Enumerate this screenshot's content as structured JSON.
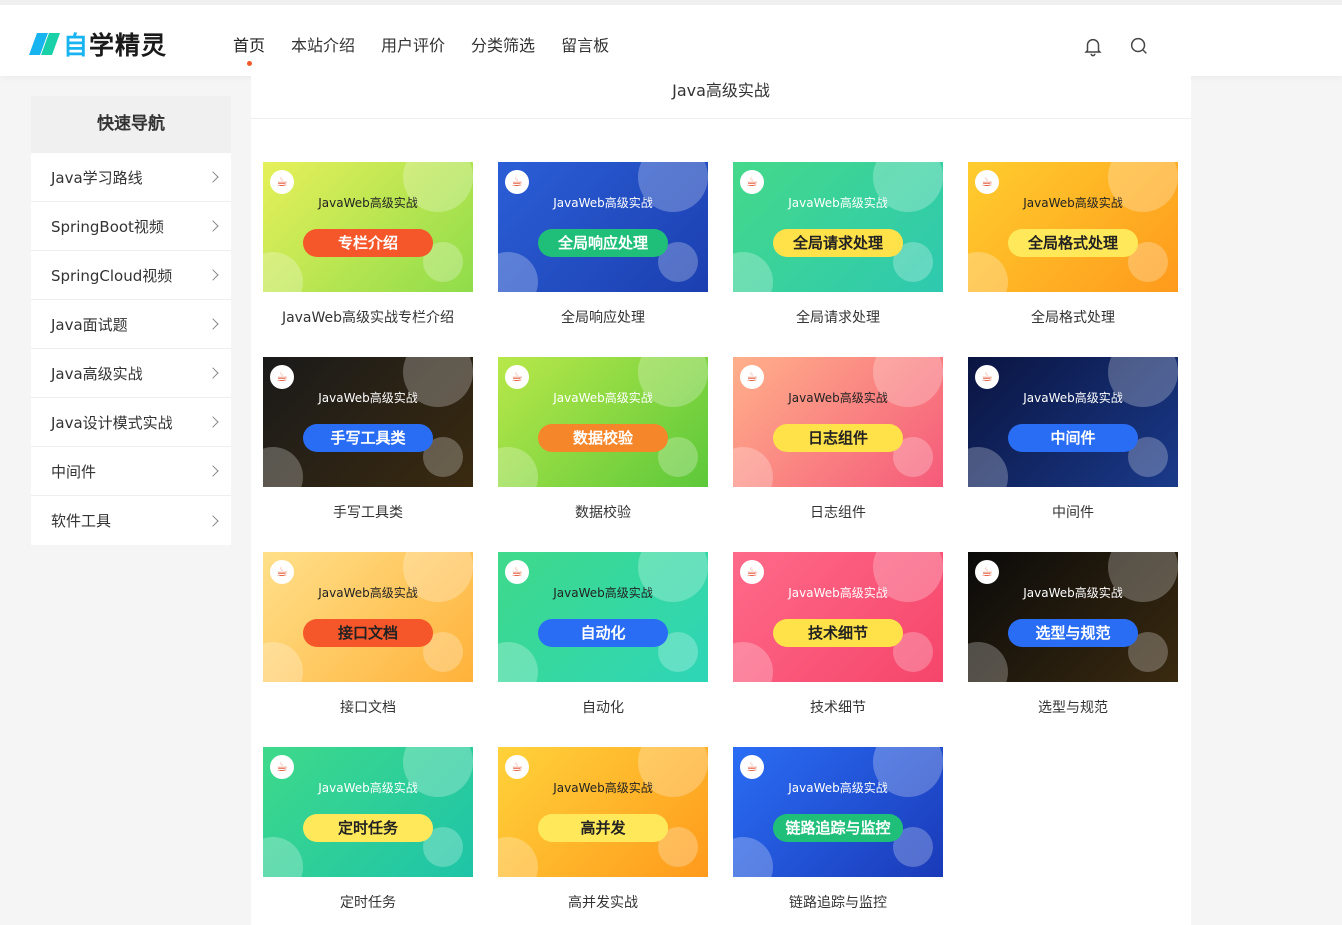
{
  "header": {
    "logo_text_1": "自",
    "logo_text_2": "学精灵",
    "nav": [
      {
        "label": "首页",
        "active": true
      },
      {
        "label": "本站介绍"
      },
      {
        "label": "用户评价"
      },
      {
        "label": "分类筛选"
      },
      {
        "label": "留言板"
      }
    ],
    "bell_icon": "bell-icon",
    "search_icon": "search-icon"
  },
  "sidebar": {
    "title": "快速导航",
    "items": [
      {
        "label": "Java学习路线"
      },
      {
        "label": "SpringBoot视频"
      },
      {
        "label": "SpringCloud视频"
      },
      {
        "label": "Java面试题"
      },
      {
        "label": "Java高级实战"
      },
      {
        "label": "Java设计模式实战"
      },
      {
        "label": "中间件"
      },
      {
        "label": "软件工具"
      }
    ]
  },
  "main": {
    "title": "Java高级实战",
    "card_subtitle": "JavaWeb高级实战",
    "cards": [
      {
        "pill": "专栏介绍",
        "caption": "JavaWeb高级实战专栏介绍",
        "bg": "linear-gradient(135deg,#e6f05a,#8fdc4a)",
        "pill_bg": "#f5562a",
        "pill_fg": "#fff",
        "sub_light": false
      },
      {
        "pill": "全局响应处理",
        "caption": "全局响应处理",
        "bg": "linear-gradient(135deg,#2b5ed6,#1b3fb0)",
        "pill_bg": "#1fbf7a",
        "pill_fg": "#fff",
        "sub_light": true
      },
      {
        "pill": "全局请求处理",
        "caption": "全局请求处理",
        "bg": "linear-gradient(135deg,#44d98a,#2ec9b0)",
        "pill_bg": "#ffe14a",
        "pill_fg": "#222",
        "sub_light": true
      },
      {
        "pill": "全局格式处理",
        "caption": "全局格式处理",
        "bg": "linear-gradient(135deg,#ffcd2e,#ff9a1c)",
        "pill_bg": "#ffe95a",
        "pill_fg": "#222",
        "sub_light": false
      },
      {
        "pill": "手写工具类",
        "caption": "手写工具类",
        "bg": "linear-gradient(135deg,#1a1a1a,#3a2a10)",
        "pill_bg": "#2a6df5",
        "pill_fg": "#fff",
        "sub_light": true
      },
      {
        "pill": "数据校验",
        "caption": "数据校验",
        "bg": "linear-gradient(135deg,#b8e84a,#5cc83a)",
        "pill_bg": "#f5862a",
        "pill_fg": "#fff",
        "sub_light": true
      },
      {
        "pill": "日志组件",
        "caption": "日志组件",
        "bg": "linear-gradient(135deg,#ffb08a,#f55a7a)",
        "pill_bg": "#ffe14a",
        "pill_fg": "#222",
        "sub_light": false
      },
      {
        "pill": "中间件",
        "caption": "中间件",
        "bg": "linear-gradient(135deg,#0a1440,#1a3a8a)",
        "pill_bg": "#2a6df5",
        "pill_fg": "#fff",
        "sub_light": true
      },
      {
        "pill": "接口文档",
        "caption": "接口文档",
        "bg": "linear-gradient(135deg,#ffe08a,#ffb23a)",
        "pill_bg": "#f5562a",
        "pill_fg": "#222",
        "sub_light": false
      },
      {
        "pill": "自动化",
        "caption": "自动化",
        "bg": "linear-gradient(135deg,#3ed98a,#2ed6b8)",
        "pill_bg": "#2a6df5",
        "pill_fg": "#fff",
        "sub_light": false
      },
      {
        "pill": "技术细节",
        "caption": "技术细节",
        "bg": "linear-gradient(135deg,#ff6a8a,#f5456a)",
        "pill_bg": "#ffe14a",
        "pill_fg": "#222",
        "sub_light": true
      },
      {
        "pill": "选型与规范",
        "caption": "选型与规范",
        "bg": "linear-gradient(135deg,#0a0a0a,#3a2a10)",
        "pill_bg": "#2a6df5",
        "pill_fg": "#fff",
        "sub_light": true
      },
      {
        "pill": "定时任务",
        "caption": "定时任务",
        "bg": "linear-gradient(135deg,#3ed98a,#1ec4a8)",
        "pill_bg": "#ffe95a",
        "pill_fg": "#222",
        "sub_light": true
      },
      {
        "pill": "高并发",
        "caption": "高并发实战",
        "bg": "linear-gradient(135deg,#ffd23a,#ff9a1c)",
        "pill_bg": "#ffe95a",
        "pill_fg": "#222",
        "sub_light": false
      },
      {
        "pill": "链路追踪与监控",
        "caption": "链路追踪与监控",
        "bg": "linear-gradient(135deg,#2a6df5,#1a3ab8)",
        "pill_bg": "#1fbf7a",
        "pill_fg": "#fff",
        "sub_light": true
      }
    ]
  }
}
